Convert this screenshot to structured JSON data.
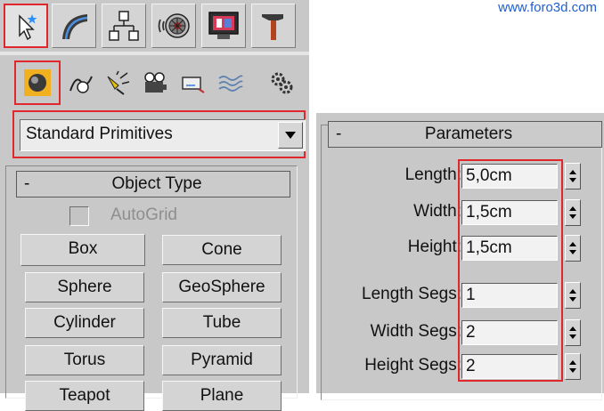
{
  "watermark": "www.foro3d.com",
  "tabs": [
    {
      "name": "create-tab",
      "icon": "create-cursor-icon",
      "active": true
    },
    {
      "name": "modify-tab",
      "icon": "modify-arc-icon",
      "active": false
    },
    {
      "name": "hierarchy-tab",
      "icon": "hierarchy-icon",
      "active": false
    },
    {
      "name": "motion-tab",
      "icon": "motion-wheel-icon",
      "active": false
    },
    {
      "name": "display-tab",
      "icon": "display-monitor-icon",
      "active": false
    },
    {
      "name": "utilities-tab",
      "icon": "hammer-icon",
      "active": false
    }
  ],
  "categories": [
    {
      "name": "geometry",
      "icon": "sphere-icon",
      "active": true
    },
    {
      "name": "shapes",
      "icon": "shapes-icon"
    },
    {
      "name": "lights",
      "icon": "light-icon"
    },
    {
      "name": "cameras",
      "icon": "camera-icon"
    },
    {
      "name": "helpers",
      "icon": "helper-icon"
    },
    {
      "name": "space-warps",
      "icon": "spacewarp-icon"
    },
    {
      "name": "systems",
      "icon": "gears-icon"
    }
  ],
  "dropdown": {
    "selected": "Standard Primitives"
  },
  "object_type": {
    "minus": "-",
    "title": "Object Type",
    "autogrid": "AutoGrid",
    "buttons": [
      "Box",
      "Cone",
      "Sphere",
      "GeoSphere",
      "Cylinder",
      "Tube",
      "Torus",
      "Pyramid",
      "Teapot",
      "Plane"
    ]
  },
  "parameters": {
    "minus": "-",
    "title": "Parameters",
    "fields": [
      {
        "label": "Length:",
        "value": "5,0cm"
      },
      {
        "label": "Width:",
        "value": "1,5cm"
      },
      {
        "label": "Height:",
        "value": "1,5cm"
      },
      {
        "label": "Length Segs:",
        "value": "1"
      },
      {
        "label": "Width Segs:",
        "value": "2"
      },
      {
        "label": "Height Segs:",
        "value": "2"
      }
    ]
  },
  "colors": {
    "highlight": "#e0282c",
    "panel": "#c8c8c8",
    "watermark": "#1f5fcf"
  }
}
